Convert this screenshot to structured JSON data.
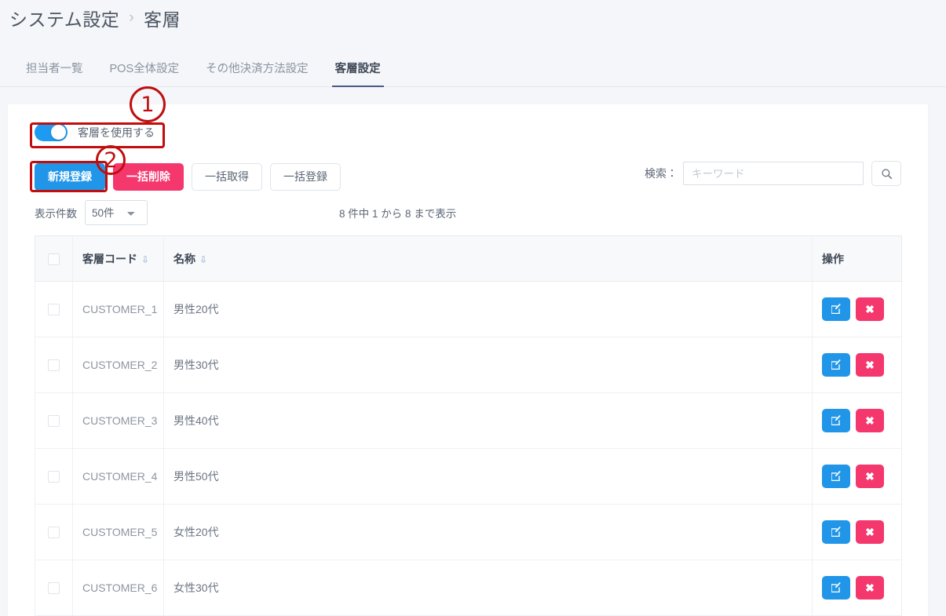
{
  "breadcrumb": {
    "parent": "システム設定",
    "separator": "›",
    "current": "客層"
  },
  "tabs": [
    {
      "label": "担当者一覧",
      "active": false
    },
    {
      "label": "POS全体設定",
      "active": false
    },
    {
      "label": "その他決済方法設定",
      "active": false
    },
    {
      "label": "客層設定",
      "active": true
    }
  ],
  "toggle": {
    "label": "客層を使用する",
    "state": "on"
  },
  "buttons": {
    "new": "新規登録",
    "bulk_delete": "一括削除",
    "bulk_fetch": "一括取得",
    "bulk_register": "一括登録"
  },
  "search": {
    "label": "検索：",
    "placeholder": "キーワード",
    "value": "",
    "icon": "search-icon"
  },
  "display": {
    "count_label": "表示件数",
    "count_value": "50件",
    "count_options": [
      "50件"
    ],
    "summary": "8 件中 1 から 8 まで表示"
  },
  "table": {
    "headers": {
      "check": "",
      "code": "客層コード",
      "name": "名称",
      "ops": "操作"
    },
    "sort_icon": "»",
    "rows": [
      {
        "code": "CUSTOMER_1",
        "name": "男性20代",
        "checked": false
      },
      {
        "code": "CUSTOMER_2",
        "name": "男性30代",
        "checked": false
      },
      {
        "code": "CUSTOMER_3",
        "name": "男性40代",
        "checked": false
      },
      {
        "code": "CUSTOMER_4",
        "name": "男性50代",
        "checked": false
      },
      {
        "code": "CUSTOMER_5",
        "name": "女性20代",
        "checked": false
      },
      {
        "code": "CUSTOMER_6",
        "name": "女性30代",
        "checked": false
      }
    ],
    "row_actions": {
      "edit_icon": "edit-icon",
      "delete_icon": "close-icon",
      "delete_glyph": "✖"
    }
  },
  "annotations": [
    {
      "number": "1",
      "target": "toggle-row"
    },
    {
      "number": "2",
      "target": "new-register-button"
    }
  ],
  "colors": {
    "primary": "#2196e8",
    "danger": "#f4376d",
    "annotation": "#c00d0d",
    "tab_active_underline": "#4a5a86"
  }
}
